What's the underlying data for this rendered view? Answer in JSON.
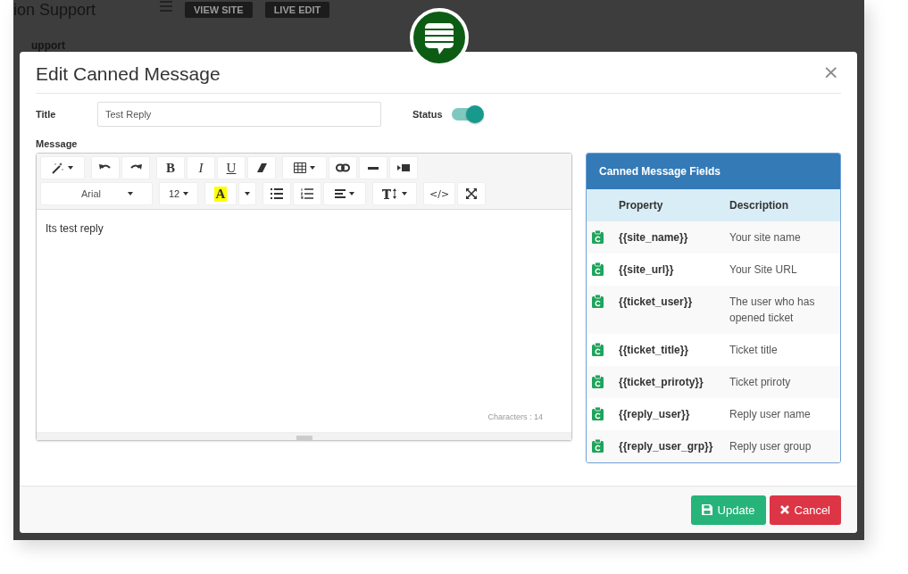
{
  "background": {
    "brand": "ion Support",
    "buttons": [
      "VIEW SITE",
      "LIVE EDIT"
    ],
    "sidebar_label": "upport"
  },
  "dialog": {
    "title": "Edit Canned Message",
    "close": "×"
  },
  "form": {
    "title_label": "Title",
    "title_value": "Test Reply",
    "status_label": "Status",
    "status_on": true,
    "message_label": "Message"
  },
  "editor": {
    "toolbar": [
      [
        [
          {
            "kind": "magic",
            "caret": true
          }
        ],
        [
          {
            "kind": "undo"
          },
          {
            "kind": "redo"
          }
        ],
        [
          {
            "kind": "bold",
            "label": "B"
          },
          {
            "kind": "italic",
            "label": "I"
          },
          {
            "kind": "underline",
            "label": "U"
          },
          {
            "kind": "eraser"
          }
        ],
        [
          {
            "kind": "table",
            "caret": true
          },
          {
            "kind": "link"
          },
          {
            "kind": "hr"
          },
          {
            "kind": "video"
          }
        ]
      ],
      [
        [
          {
            "kind": "font",
            "label": "Arial",
            "caret": true
          }
        ],
        [
          {
            "kind": "size",
            "label": "12",
            "caret": true
          }
        ],
        [
          {
            "kind": "color",
            "label": "A"
          },
          {
            "kind": "caret"
          }
        ],
        [
          {
            "kind": "ul"
          },
          {
            "kind": "ol"
          },
          {
            "kind": "align",
            "caret": true
          }
        ],
        [
          {
            "kind": "lineheight",
            "caret": true
          }
        ],
        [
          {
            "kind": "code",
            "label": "</>"
          },
          {
            "kind": "fullscreen"
          }
        ]
      ]
    ],
    "content": "Its test reply",
    "char_count": "Characters : 14"
  },
  "fields_panel": {
    "title": "Canned Message Fields",
    "columns": [
      "Property",
      "Description"
    ],
    "rows": [
      {
        "property": "{{site_name}}",
        "description": "Your site name"
      },
      {
        "property": "{{site_url}}",
        "description": "Your Site URL"
      },
      {
        "property": "{{ticket_user}}",
        "description": "The user who has opened ticket"
      },
      {
        "property": "{{ticket_title}}",
        "description": "Ticket title"
      },
      {
        "property": "{{ticket_priroty}}",
        "description": "Ticket priroty"
      },
      {
        "property": "{{reply_user}}",
        "description": "Reply user name"
      },
      {
        "property": "{{reply_user_grp}}",
        "description": "Reply user group"
      }
    ]
  },
  "buttons": [
    {
      "kind": "primary",
      "label": "Update"
    },
    {
      "kind": "danger",
      "label": "Cancel"
    }
  ]
}
